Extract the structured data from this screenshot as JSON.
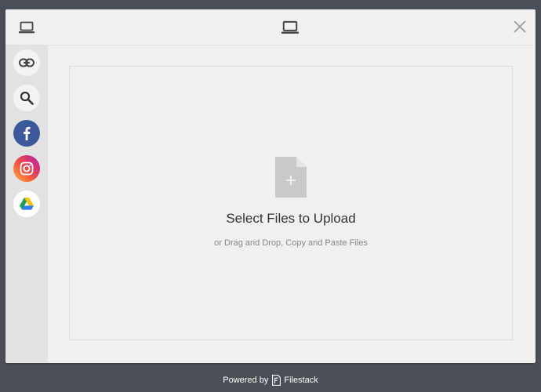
{
  "sidebar": {
    "items": [
      {
        "name": "my-device",
        "icon": "laptop-icon",
        "active": true
      },
      {
        "name": "link-url",
        "icon": "link-icon",
        "active": false
      },
      {
        "name": "web-search",
        "icon": "search-icon",
        "active": false
      },
      {
        "name": "facebook",
        "icon": "facebook-icon",
        "active": false
      },
      {
        "name": "instagram",
        "icon": "instagram-icon",
        "active": false
      },
      {
        "name": "google-drive",
        "icon": "google-drive-icon",
        "active": false
      }
    ]
  },
  "header": {
    "icon": "laptop-icon",
    "close_icon": "close-icon"
  },
  "dropzone": {
    "icon": "file-add-icon",
    "title": "Select Files to Upload",
    "subtitle": "or Drag and Drop, Copy and Paste Files"
  },
  "footer": {
    "powered_by": "Powered by",
    "brand": "Filestack"
  },
  "colors": {
    "background": "#4a4f57",
    "modal": "#f0f0f0",
    "sidebar": "#e2e2e2",
    "facebook": "#3b5998"
  }
}
